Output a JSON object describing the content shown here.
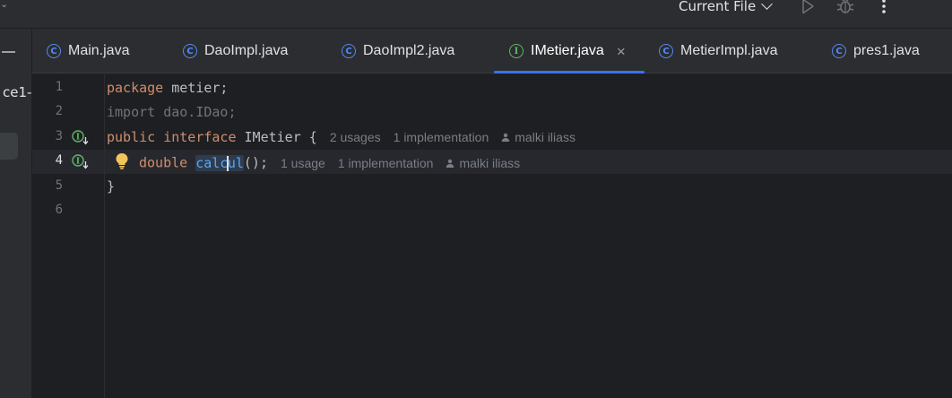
{
  "toolbar": {
    "corner_glyph": "⌄",
    "run_config_label": "Current File",
    "run_icon": "run-icon",
    "debug_icon": "debug-icon",
    "more_icon": "more-vertical-icon"
  },
  "left_strip": {
    "project_name_fragment": "ce1-"
  },
  "tabs": [
    {
      "label": "Main.java",
      "icon": "class-icon",
      "icon_glyph": "C"
    },
    {
      "label": "DaoImpl.java",
      "icon": "class-icon",
      "icon_glyph": "C"
    },
    {
      "label": "DaoImpl2.java",
      "icon": "class-icon",
      "icon_glyph": "C"
    },
    {
      "label": "IMetier.java",
      "icon": "interface-icon",
      "icon_glyph": "I",
      "active": true,
      "close_glyph": "×"
    },
    {
      "label": "MetierImpl.java",
      "icon": "class-icon",
      "icon_glyph": "C"
    },
    {
      "label": "pres1.java",
      "icon": "class-icon",
      "icon_glyph": "C"
    }
  ],
  "editor": {
    "line_numbers": [
      "1",
      "2",
      "3",
      "4",
      "5",
      "6"
    ],
    "current_line": 4,
    "line1": {
      "kw": "package",
      "rest": " metier;"
    },
    "line2": {
      "text": "import dao.IDao;"
    },
    "line3": {
      "kw1": "public",
      "kw2": "interface",
      "name": " IMetier {",
      "hint_usages": "2 usages",
      "hint_impl": "1 implementation",
      "hint_author": "malki iliass"
    },
    "line4": {
      "type": "double",
      "method_before_caret": "calc",
      "method_after_caret": "ul",
      "tail": "();",
      "hint_usages": "1 usage",
      "hint_impl": "1 implementation",
      "hint_author": "malki iliass"
    },
    "line5": {
      "text": "}"
    },
    "colors": {
      "keyword": "#cf8e6d",
      "method": "#56a8f5",
      "comment_dim": "#6f737a",
      "accent": "#3574f0"
    }
  }
}
